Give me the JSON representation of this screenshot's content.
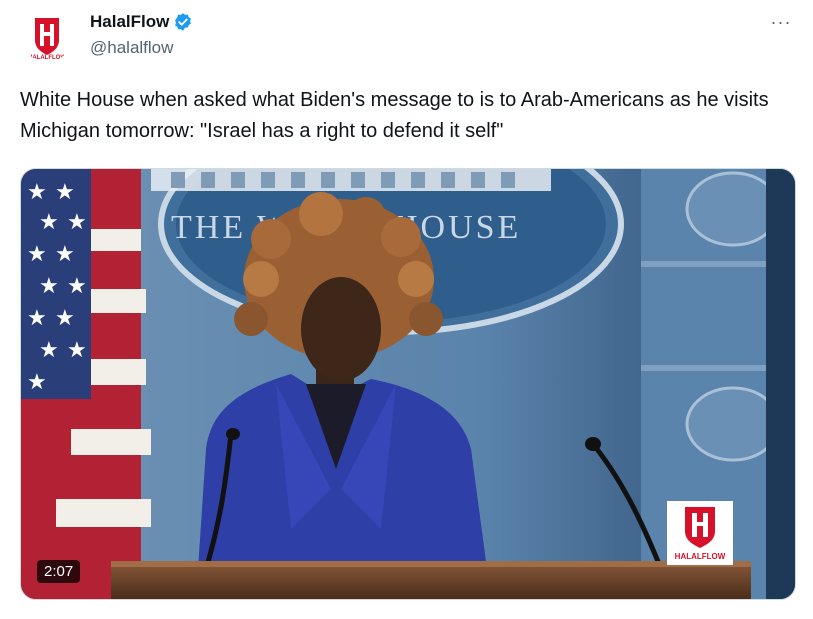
{
  "author": {
    "display_name": "HalalFlow",
    "handle": "@halalflow",
    "verified": true,
    "avatar_logo_text": "HALALFLOW"
  },
  "more_menu": {
    "icon": "more-horizontal-icon",
    "glyph": "···"
  },
  "tweet": {
    "text": "White House when asked what Biden's message to is to Arab-Americans as he visits Michigan tomorrow: \"Israel has a right to defend it self\""
  },
  "video": {
    "duration": "2:07",
    "backdrop_text": "THE WHITE HOUSE",
    "watermark_text": "HALALFLOW"
  },
  "colors": {
    "verified_badge": "#1d9bf0",
    "brand_red": "#d8112a",
    "backdrop_blue": "#4f7aa3",
    "blazer_blue": "#2f3fa8"
  }
}
